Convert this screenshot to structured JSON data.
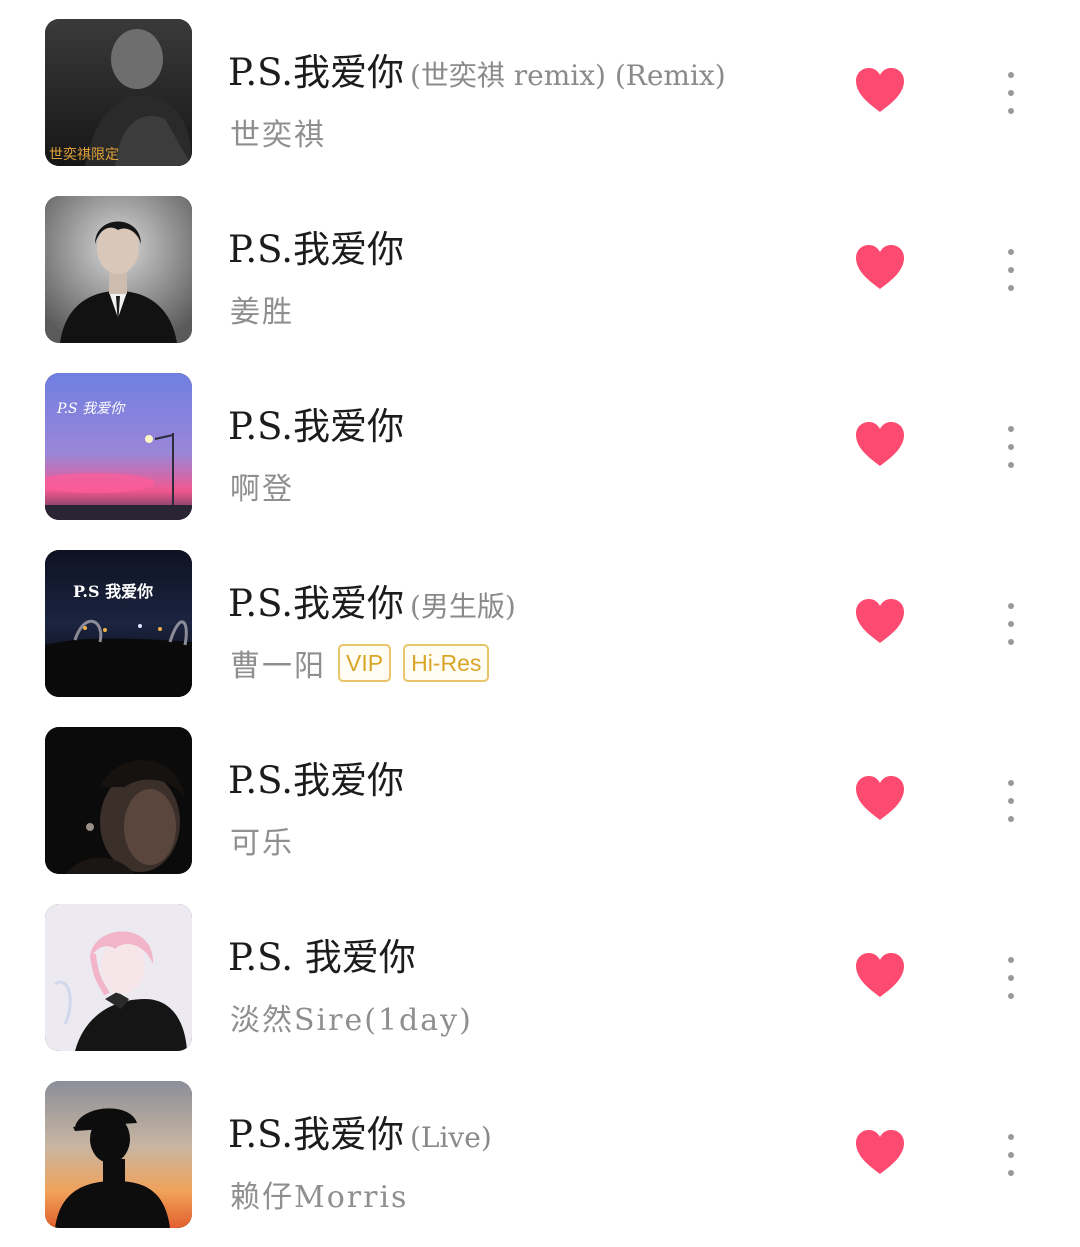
{
  "songs": [
    {
      "title": "P.S.我爱你",
      "suffix": "(世奕祺 remix) (Remix)",
      "artist": "世奕祺",
      "badges": [],
      "liked": true,
      "cover_text": "世奕祺限定",
      "cover_icon": "cover-art-remix"
    },
    {
      "title": "P.S.我爱你",
      "suffix": "",
      "artist": "姜胜",
      "badges": [],
      "liked": true,
      "cover_text": "",
      "cover_icon": "cover-art-portrait-suit"
    },
    {
      "title": "P.S.我爱你",
      "suffix": "",
      "artist": "啊登",
      "badges": [],
      "liked": true,
      "cover_text": "P.S 我爱你",
      "cover_icon": "cover-art-sunset-sky"
    },
    {
      "title": "P.S.我爱你",
      "suffix": "(男生版)",
      "artist": "曹一阳",
      "badges": [
        "VIP",
        "Hi-Res"
      ],
      "liked": true,
      "cover_text": "P.S 我爱你",
      "cover_icon": "cover-art-night-car"
    },
    {
      "title": "P.S.我爱你",
      "suffix": "",
      "artist": "可乐",
      "badges": [],
      "liked": true,
      "cover_text": "",
      "cover_icon": "cover-art-dark-portrait"
    },
    {
      "title": "P.S. 我爱你",
      "suffix": "",
      "artist": "淡然Sire(1day)",
      "badges": [],
      "liked": true,
      "cover_text": "",
      "cover_icon": "cover-art-anime-boy"
    },
    {
      "title": "P.S.我爱你",
      "suffix": "(Live)",
      "artist": "赖仔Morris",
      "badges": [],
      "liked": true,
      "cover_text": "",
      "cover_icon": "cover-art-silhouette-sunset"
    }
  ],
  "colors": {
    "heart": "#fd4a70",
    "badge_border": "#e8c56a",
    "badge_text": "#d9a62a",
    "title": "#1c1c1c",
    "subtitle": "#8f8f8f"
  },
  "icons": {
    "like": "heart-icon",
    "more": "more-vertical-icon"
  }
}
